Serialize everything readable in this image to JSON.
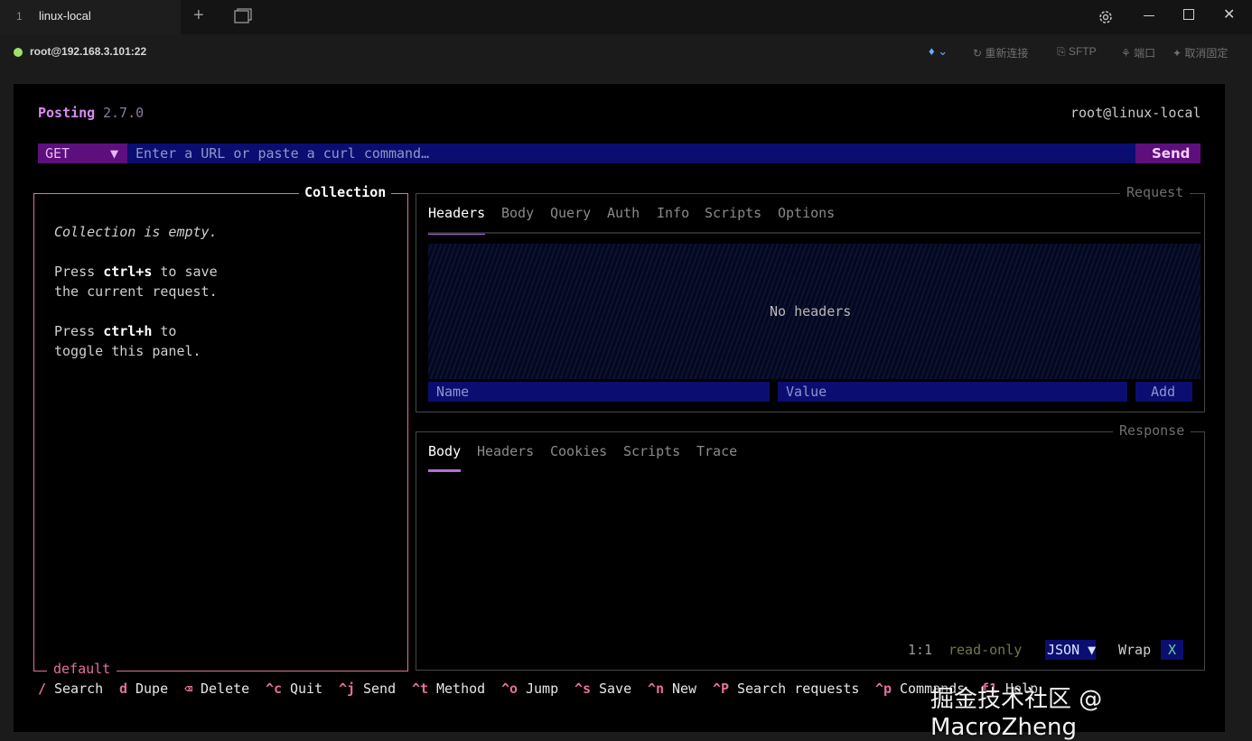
{
  "window": {
    "tab_number": "1",
    "tab_title": "linux-local",
    "new_tab_icon": "plus-icon",
    "tabs_icon": "windows-icon",
    "settings_icon": "gear-icon"
  },
  "session": {
    "host": "root@192.168.3.101:22",
    "status_color": "#9fe06a",
    "toolbar": {
      "bulb_icon": "lightbulb-icon",
      "reconnect": "↻ 重新连接",
      "sftp": "⎘ SFTP",
      "port": "⚘ 端口",
      "unpin": "✦ 取消固定"
    }
  },
  "posting": {
    "app_name": "Posting",
    "version": "2.7.0",
    "user_host": "root@linux-local",
    "method": "GET",
    "method_arrow": "▼",
    "url_placeholder": "Enter a URL or paste a curl command…",
    "send": "Send"
  },
  "collection": {
    "title": "Collection",
    "empty": "Collection is empty.",
    "save_hint_1": "Press ",
    "save_key": "ctrl+s",
    "save_hint_2": " to save",
    "save_hint_3": "the current request.",
    "toggle_hint_1": "Press ",
    "toggle_key": "ctrl+h",
    "toggle_hint_2": " to",
    "toggle_hint_3": "toggle this panel.",
    "footer": "default"
  },
  "request": {
    "label": "Request",
    "tabs": [
      "Headers",
      "Body",
      "Query",
      "Auth",
      "Info",
      "Scripts",
      "Options"
    ],
    "no_headers": "No headers",
    "name_placeholder": "Name",
    "value_placeholder": "Value",
    "add": "Add"
  },
  "response": {
    "label": "Response",
    "tabs": [
      "Body",
      "Headers",
      "Cookies",
      "Scripts",
      "Trace"
    ],
    "cursor": "1:1",
    "mode": "read-only",
    "language": "JSON ▼",
    "wrap_label": "Wrap",
    "wrap_value": "X"
  },
  "footer": [
    {
      "key": "/",
      "label": "Search"
    },
    {
      "key": "d",
      "label": "Dupe"
    },
    {
      "key": "⌫",
      "label": "Delete"
    },
    {
      "key": "^c",
      "label": "Quit"
    },
    {
      "key": "^j",
      "label": "Send"
    },
    {
      "key": "^t",
      "label": "Method"
    },
    {
      "key": "^o",
      "label": "Jump"
    },
    {
      "key": "^s",
      "label": "Save"
    },
    {
      "key": "^n",
      "label": "New"
    },
    {
      "key": "^P",
      "label": "Search requests"
    },
    {
      "key": "^p",
      "label": "Commands"
    },
    {
      "key": "f1",
      "label": "Help"
    }
  ],
  "watermark": "掘金技术社区 @ MacroZheng",
  "colors": {
    "accent": "#b66ce0",
    "collection_border": "#e46f9f",
    "input_bg": "#0b0e70",
    "method_bg": "#5c0f7d"
  }
}
